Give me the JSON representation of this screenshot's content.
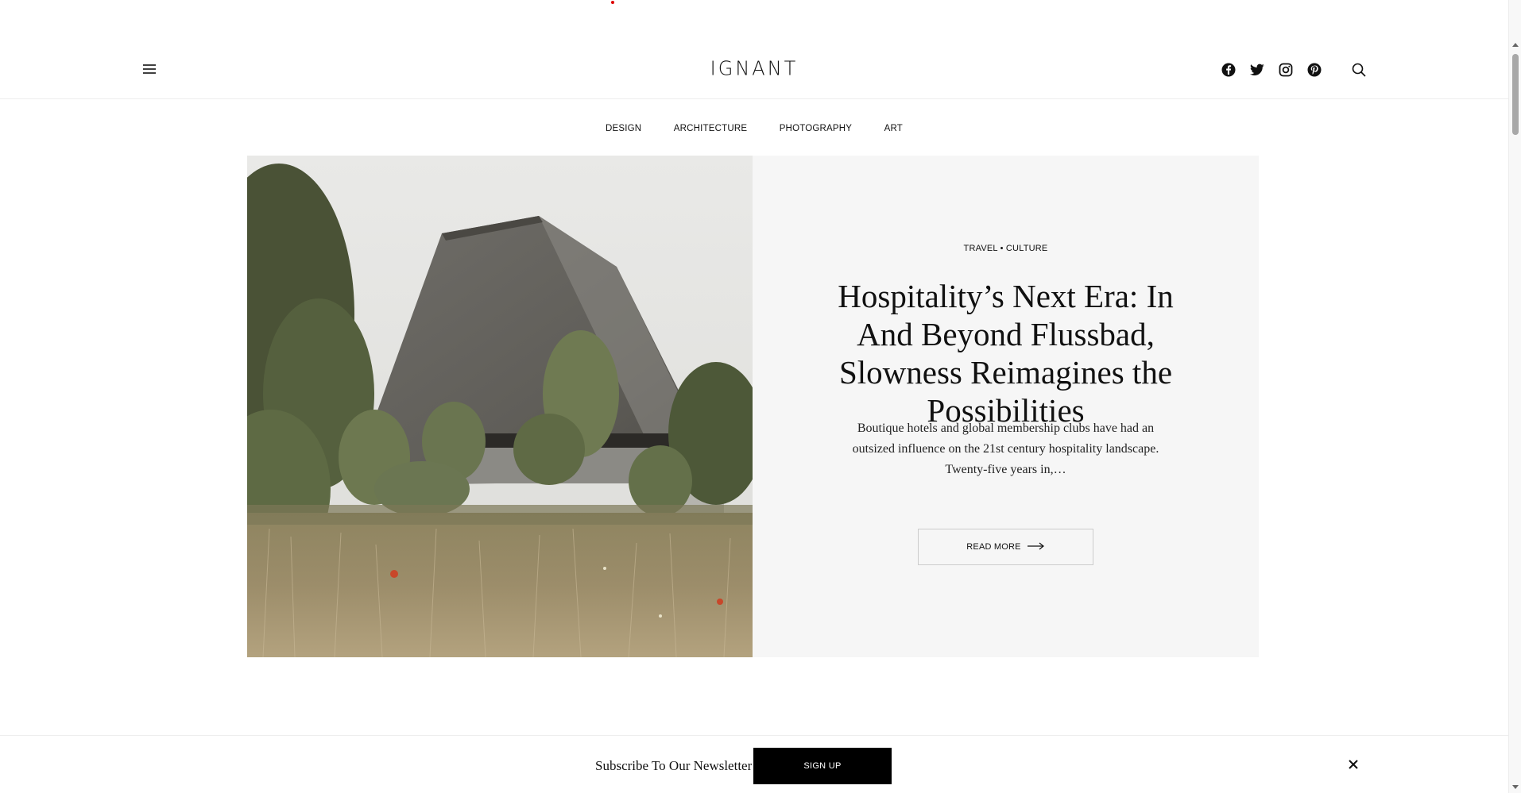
{
  "header": {
    "logo": "IGNANT",
    "menu_icon": "hamburger-icon",
    "social": [
      {
        "name": "facebook",
        "icon": "facebook-icon"
      },
      {
        "name": "twitter",
        "icon": "twitter-icon"
      },
      {
        "name": "instagram",
        "icon": "instagram-icon"
      },
      {
        "name": "pinterest",
        "icon": "pinterest-icon"
      }
    ],
    "search_icon": "search-icon"
  },
  "nav": {
    "items": [
      "DESIGN",
      "ARCHITECTURE",
      "PHOTOGRAPHY",
      "ART"
    ]
  },
  "hero": {
    "categories": [
      "TRAVEL",
      "CULTURE"
    ],
    "category_separator": "•",
    "title": "Hospitality’s Next Era: In And Beyond Flussbad, Slowness Reimagines the Possibilities",
    "excerpt": "Boutique hotels and global membership clubs have had an outsized influence on the 21st century hospitality landscape. Twenty-five years in,…",
    "read_more_label": "READ MORE",
    "read_more_icon": "arrow-right-icon"
  },
  "newsletter": {
    "label": "Subscribe To Our Newsletter",
    "button_label": "SIGN UP",
    "close_icon": "close-icon"
  },
  "colors": {
    "text": "#111111",
    "panel_bg": "#f6f6f6",
    "button_bg": "#000000",
    "accent_dot": "#dd0000"
  }
}
